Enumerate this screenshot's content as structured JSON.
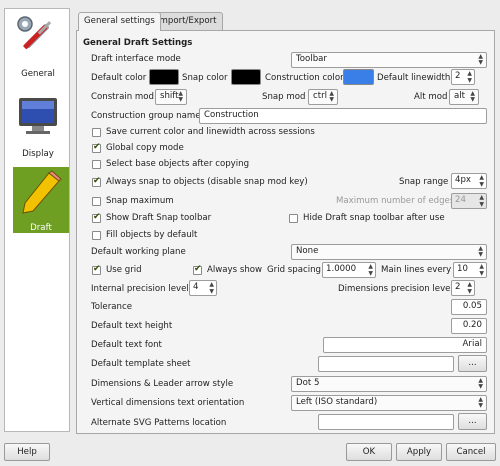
{
  "sidebar": {
    "items": [
      {
        "label": "General",
        "icon": "tools-icon"
      },
      {
        "label": "Display",
        "icon": "monitor-icon"
      },
      {
        "label": "Draft",
        "icon": "pencil-icon",
        "active": true
      }
    ],
    "active_color": "#6e9e22"
  },
  "tabs": [
    "General settings",
    "Import/Export"
  ],
  "section_title": "General Draft Settings",
  "interface_mode": {
    "label": "Draft interface mode",
    "value": "Toolbar"
  },
  "colors_row": {
    "default_color_label": "Default color",
    "default_color": "#000000",
    "snap_color_label": "Snap color",
    "snap_color": "#000000",
    "construction_color_label": "Construction color",
    "construction_color": "#3a7ee8",
    "linewidth_label": "Default linewidth",
    "linewidth_value": "2"
  },
  "mods_row": {
    "constrain_label": "Constrain mod",
    "constrain_value": "shift",
    "snap_label": "Snap mod",
    "snap_value": "ctrl",
    "alt_label": "Alt mod",
    "alt_value": "alt"
  },
  "construction_group": {
    "label": "Construction group name",
    "value": "Construction"
  },
  "checkboxes": {
    "save_color": {
      "label": "Save current color and linewidth across sessions",
      "checked": false
    },
    "global_copy": {
      "label": "Global copy mode",
      "checked": true
    },
    "select_base": {
      "label": "Select base objects after copying",
      "checked": false
    },
    "always_snap": {
      "label": "Always snap to objects (disable snap mod key)",
      "checked": true
    },
    "snap_maximum": {
      "label": "Snap maximum",
      "checked": false
    },
    "show_snap_toolbar": {
      "label": "Show Draft Snap toolbar",
      "checked": true
    },
    "hide_snap_toolbar": {
      "label": "Hide Draft snap toolbar after use",
      "checked": false
    },
    "fill_objects": {
      "label": "Fill objects by default",
      "checked": false
    },
    "use_grid": {
      "label": "Use grid",
      "checked": true
    },
    "always_show": {
      "label": "Always show",
      "checked": true
    }
  },
  "snap_range": {
    "label": "Snap range",
    "value": "4px"
  },
  "max_edges": {
    "label": "Maximum number of edges",
    "value": "24"
  },
  "working_plane": {
    "label": "Default working plane",
    "value": "None"
  },
  "grid": {
    "spacing_label": "Grid spacing",
    "spacing_value": "1.0000",
    "main_lines_label": "Main lines every",
    "main_lines_value": "10"
  },
  "precision": {
    "internal_label": "Internal precision level",
    "internal_value": "4",
    "dimensions_label": "Dimensions precision level",
    "dimensions_value": "2"
  },
  "tolerance": {
    "label": "Tolerance",
    "value": "0.05"
  },
  "text_height": {
    "label": "Default text height",
    "value": "0.20"
  },
  "text_font": {
    "label": "Default text font",
    "value": "Arial"
  },
  "template_sheet": {
    "label": "Default template sheet",
    "value": "",
    "browse": "..."
  },
  "arrow_style": {
    "label": "Dimensions & Leader arrow style",
    "value": "Dot 5"
  },
  "text_orientation": {
    "label": "Vertical dimensions text orientation",
    "value": "Left (ISO standard)"
  },
  "svg_patterns": {
    "label": "Alternate SVG Patterns location",
    "value": "",
    "browse": "..."
  },
  "buttons": {
    "help": "Help",
    "ok": "OK",
    "apply": "Apply",
    "cancel": "Cancel"
  }
}
